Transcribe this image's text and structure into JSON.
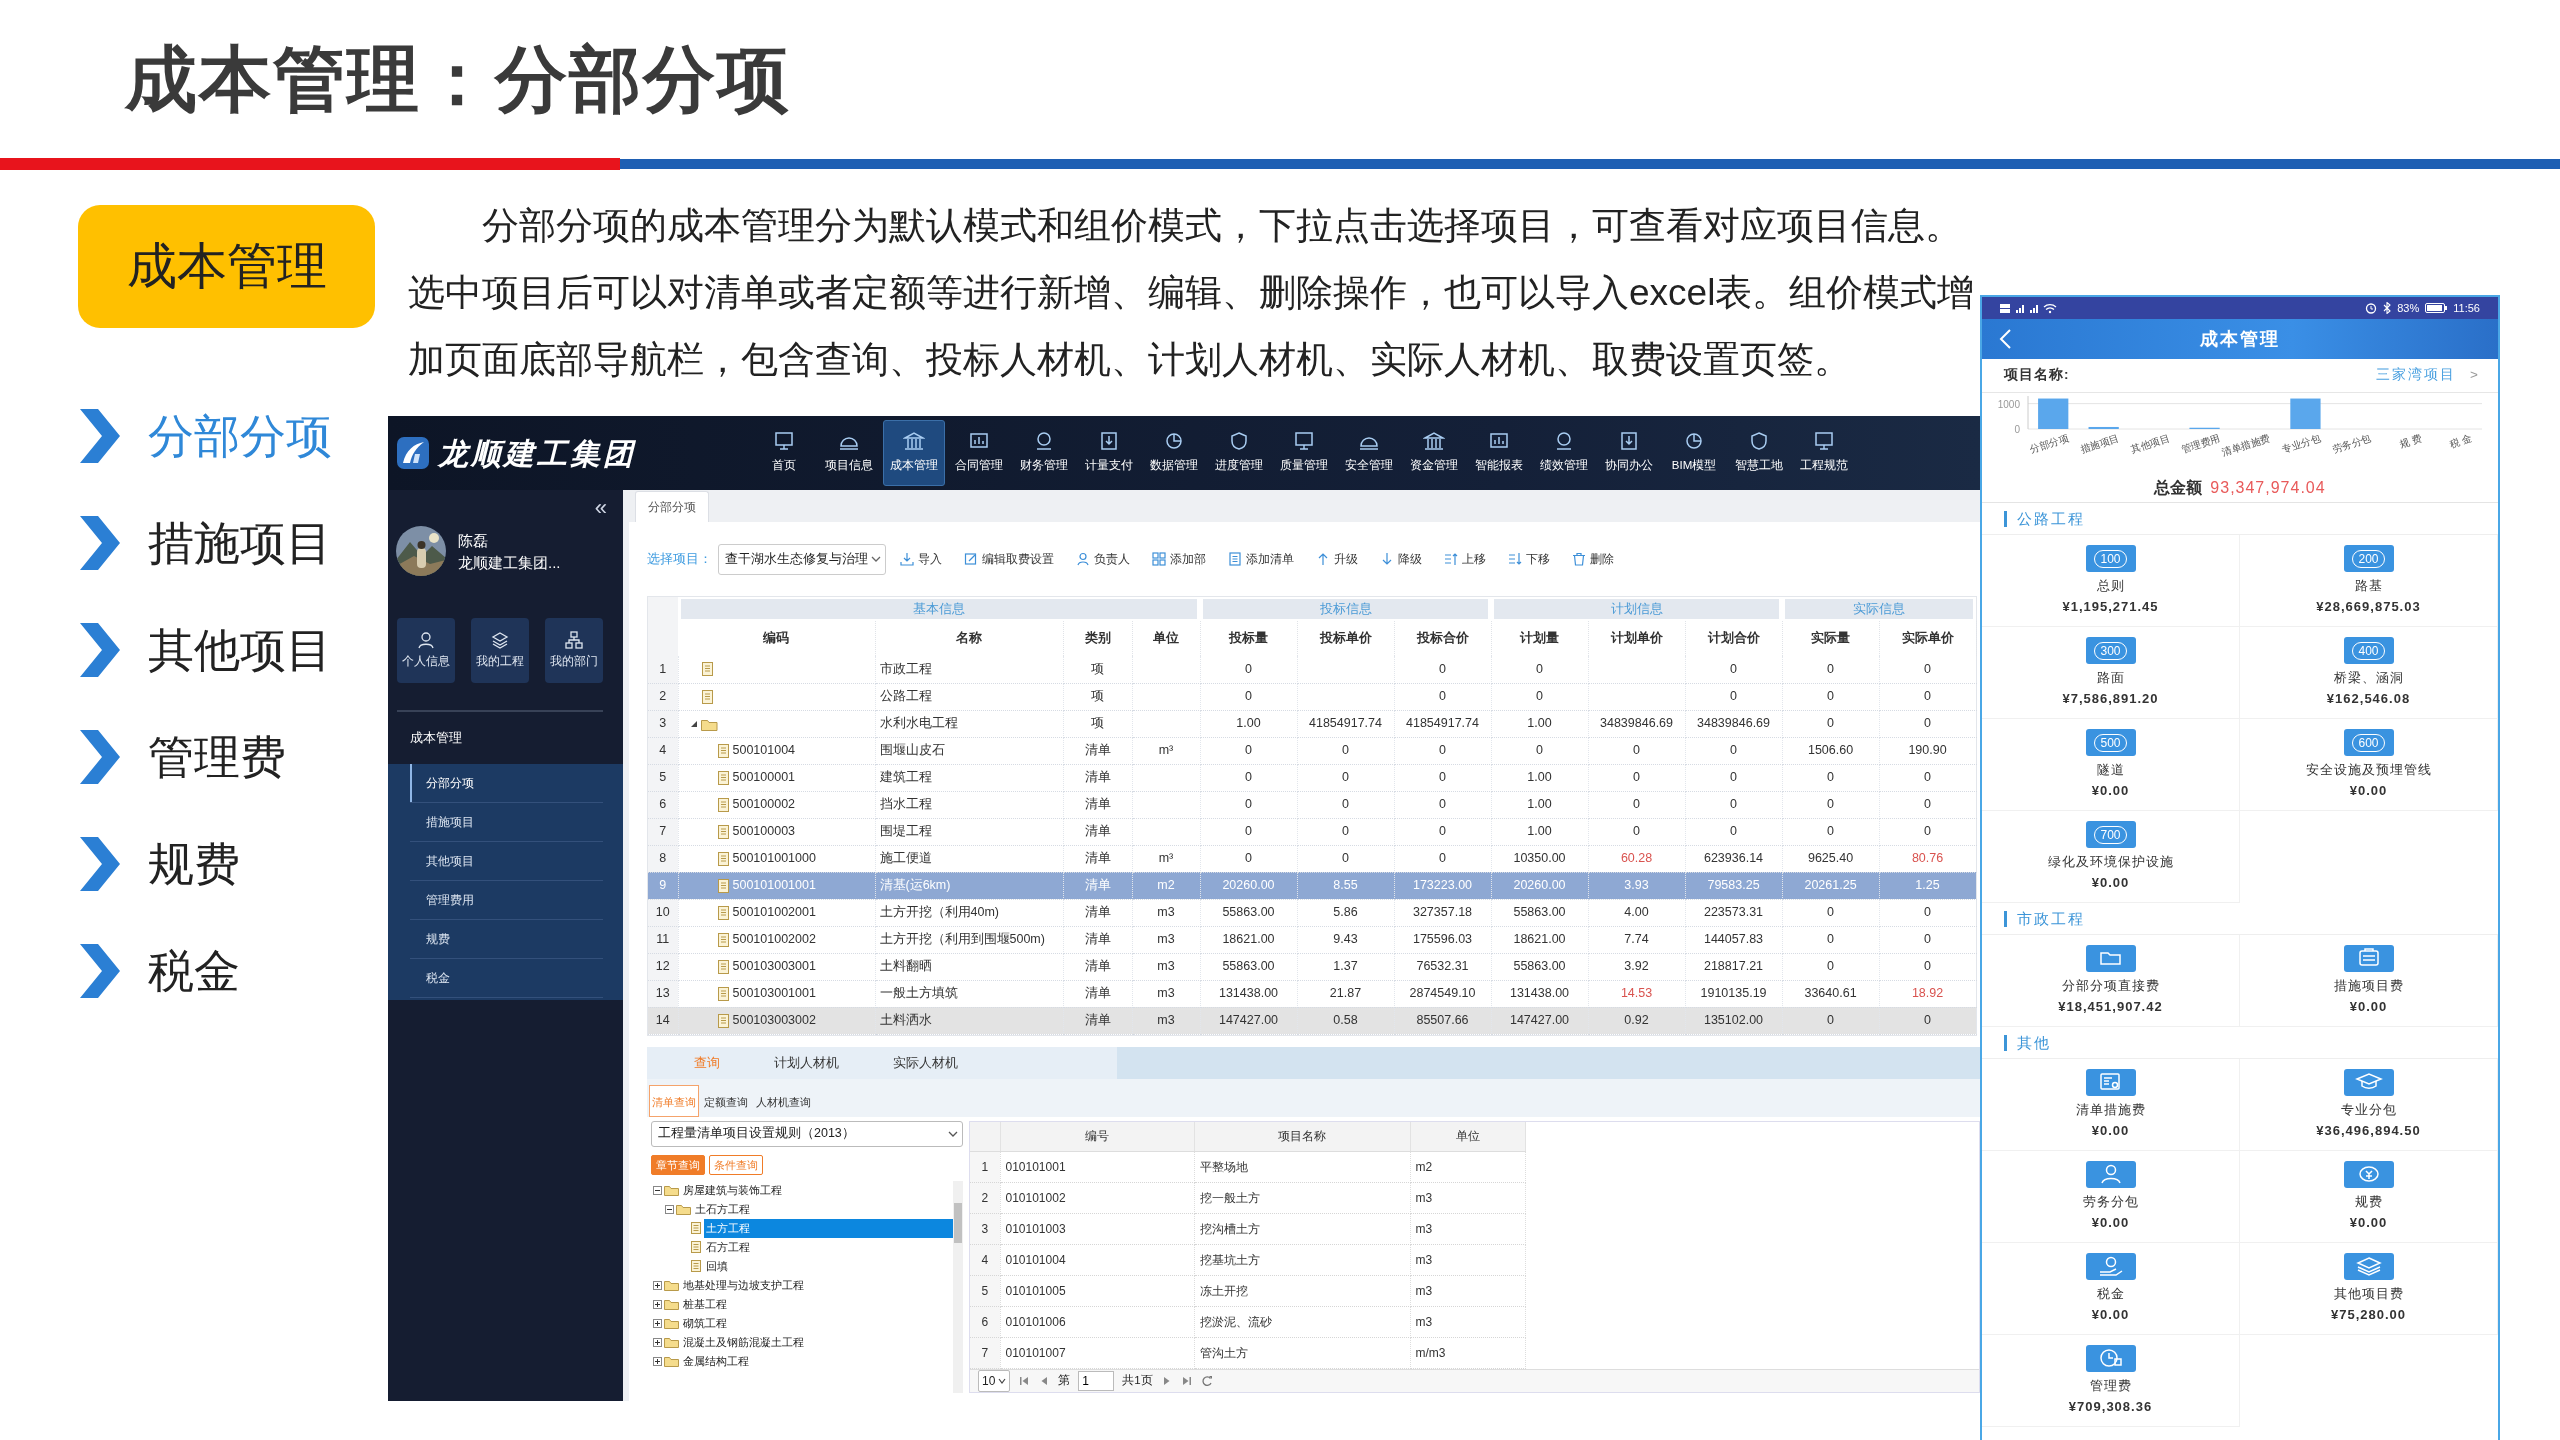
{
  "slide": {
    "title": "成本管理：分部分项"
  },
  "badge": "成本管理",
  "menu": [
    {
      "label": "分部分项",
      "selected": true
    },
    {
      "label": "措施项目",
      "selected": false
    },
    {
      "label": "其他项目",
      "selected": false
    },
    {
      "label": "管理费",
      "selected": false
    },
    {
      "label": "规费",
      "selected": false
    },
    {
      "label": "税金",
      "selected": false
    }
  ],
  "description": "分部分项的成本管理分为默认模式和组价模式，下拉点击选择项目，可查看对应项目信息。选中项目后可以对清单或者定额等进行新增、编辑、删除操作，也可以导入excel表。组价模式增加页面底部导航栏，包含查询、投标人材机、计划人材机、实际人材机、取费设置页签。",
  "app": {
    "logo": "龙顺建工集团",
    "nav": [
      {
        "label": "首页",
        "selected": false
      },
      {
        "label": "项目信息",
        "selected": false
      },
      {
        "label": "成本管理",
        "selected": true
      },
      {
        "label": "合同管理",
        "selected": false
      },
      {
        "label": "财务管理",
        "selected": false
      },
      {
        "label": "计量支付",
        "selected": false
      },
      {
        "label": "数据管理",
        "selected": false
      },
      {
        "label": "进度管理",
        "selected": false
      },
      {
        "label": "质量管理",
        "selected": false
      },
      {
        "label": "安全管理",
        "selected": false
      },
      {
        "label": "资金管理",
        "selected": false
      },
      {
        "label": "智能报表",
        "selected": false
      },
      {
        "label": "绩效管理",
        "selected": false
      },
      {
        "label": "协同办公",
        "selected": false
      },
      {
        "label": "BIM模型",
        "selected": false
      },
      {
        "label": "智慧工地",
        "selected": false
      },
      {
        "label": "工程规范",
        "selected": false
      }
    ],
    "sidebar": {
      "collapse": "«",
      "user": {
        "name": "陈磊",
        "org": "龙顺建工集团..."
      },
      "shortcuts": [
        "个人信息",
        "我的工程",
        "我的部门"
      ],
      "section": "成本管理",
      "items": [
        {
          "label": "分部分项",
          "selected": true
        },
        {
          "label": "措施项目",
          "selected": false
        },
        {
          "label": "其他项目",
          "selected": false
        },
        {
          "label": "管理费用",
          "selected": false
        },
        {
          "label": "规费",
          "selected": false
        },
        {
          "label": "税金",
          "selected": false
        }
      ]
    },
    "tab": "分部分项",
    "toolbar": {
      "project_label": "选择项目：",
      "project": "查干湖水生态修复与治理",
      "actions": [
        "导入",
        "编辑取费设置",
        "负责人",
        "添加部",
        "添加清单",
        "升级",
        "降级",
        "上移",
        "下移",
        "删除"
      ]
    },
    "table": {
      "groups": [
        "基本信息",
        "投标信息",
        "计划信息",
        "实际信息"
      ],
      "columns": [
        "编码",
        "名称",
        "类别",
        "单位",
        "投标量",
        "投标单价",
        "投标合价",
        "计划量",
        "计划单价",
        "计划合价",
        "实际量",
        "实际单价"
      ],
      "rows": [
        {
          "no": "1",
          "kind": "file",
          "name": "市政工程",
          "type": "项",
          "bid_qty": "0",
          "bid_total": "0",
          "plan_qty": "0",
          "plan_total": "0",
          "actual_qty": "0",
          "actual_price": "0",
          "selected": false,
          "hovered": false,
          "actual_price_alert": false
        },
        {
          "no": "2",
          "kind": "file",
          "name": "公路工程",
          "type": "项",
          "bid_qty": "0",
          "bid_total": "0",
          "plan_qty": "0",
          "plan_total": "0",
          "actual_qty": "0",
          "actual_price": "0",
          "selected": false,
          "hovered": false,
          "actual_price_alert": false
        },
        {
          "no": "3",
          "kind": "folder",
          "expanded": true,
          "name": "水利水电工程",
          "type": "项",
          "bid_qty": "1.00",
          "bid_price": "41854917.74",
          "bid_total": "41854917.74",
          "plan_qty": "1.00",
          "plan_price": "34839846.69",
          "plan_total": "34839846.69",
          "actual_qty": "0",
          "actual_price": "0",
          "selected": false,
          "hovered": false,
          "plan_price_alert": false,
          "actual_price_alert": false,
          "children": [
            {
              "no": "4",
              "kind": "file",
              "code": "500101004",
              "name": "围堰山皮石",
              "type": "清单",
              "unit": "m³",
              "bid_qty": "0",
              "bid_price": "0",
              "bid_total": "0",
              "plan_qty": "0",
              "plan_price": "0",
              "plan_total": "0",
              "actual_qty": "1506.60",
              "actual_price": "190.90",
              "selected": false,
              "hovered": false,
              "plan_price_alert": false,
              "actual_price_alert": false
            },
            {
              "no": "5",
              "kind": "file",
              "code": "500100001",
              "name": "建筑工程",
              "type": "清单",
              "bid_qty": "0",
              "bid_price": "0",
              "bid_total": "0",
              "plan_qty": "1.00",
              "plan_price": "0",
              "plan_total": "0",
              "actual_qty": "0",
              "actual_price": "0",
              "selected": false,
              "hovered": false,
              "plan_price_alert": false,
              "actual_price_alert": false
            },
            {
              "no": "6",
              "kind": "file",
              "code": "500100002",
              "name": "挡水工程",
              "type": "清单",
              "bid_qty": "0",
              "bid_price": "0",
              "bid_total": "0",
              "plan_qty": "1.00",
              "plan_price": "0",
              "plan_total": "0",
              "actual_qty": "0",
              "actual_price": "0",
              "selected": false,
              "hovered": false,
              "plan_price_alert": false,
              "actual_price_alert": false
            },
            {
              "no": "7",
              "kind": "file",
              "code": "500100003",
              "name": "围堤工程",
              "type": "清单",
              "bid_qty": "0",
              "bid_price": "0",
              "bid_total": "0",
              "plan_qty": "1.00",
              "plan_price": "0",
              "plan_total": "0",
              "actual_qty": "0",
              "actual_price": "0",
              "selected": false,
              "hovered": false,
              "plan_price_alert": false,
              "actual_price_alert": false
            },
            {
              "no": "8",
              "kind": "file",
              "code": "500101001000",
              "name": "施工便道",
              "type": "清单",
              "unit": "m³",
              "bid_qty": "0",
              "bid_price": "0",
              "bid_total": "0",
              "plan_qty": "10350.00",
              "plan_price": "60.28",
              "plan_total": "623936.14",
              "actual_qty": "9625.40",
              "actual_price": "80.76",
              "selected": false,
              "hovered": false,
              "plan_price_alert": true,
              "actual_price_alert": true
            },
            {
              "no": "9",
              "kind": "file",
              "code": "500101001001",
              "name": "清基(运6km)",
              "type": "清单",
              "unit": "m2",
              "bid_qty": "20260.00",
              "bid_price": "8.55",
              "bid_total": "173223.00",
              "plan_qty": "20260.00",
              "plan_price": "3.93",
              "plan_total": "79583.25",
              "actual_qty": "20261.25",
              "actual_price": "1.25",
              "selected": true,
              "hovered": false,
              "plan_price_alert": false,
              "actual_price_alert": false
            },
            {
              "no": "10",
              "kind": "file",
              "code": "500101002001",
              "name": "土方开挖（利用40m)",
              "type": "清单",
              "unit": "m3",
              "bid_qty": "55863.00",
              "bid_price": "5.86",
              "bid_total": "327357.18",
              "plan_qty": "55863.00",
              "plan_price": "4.00",
              "plan_total": "223573.31",
              "actual_qty": "0",
              "actual_price": "0",
              "selected": false,
              "hovered": false,
              "plan_price_alert": false,
              "actual_price_alert": false
            },
            {
              "no": "11",
              "kind": "file",
              "code": "500101002002",
              "name": "土方开挖（利用到围堰500m)",
              "type": "清单",
              "unit": "m3",
              "bid_qty": "18621.00",
              "bid_price": "9.43",
              "bid_total": "175596.03",
              "plan_qty": "18621.00",
              "plan_price": "7.74",
              "plan_total": "144057.83",
              "actual_qty": "0",
              "actual_price": "0",
              "selected": false,
              "hovered": false,
              "plan_price_alert": false,
              "actual_price_alert": false
            },
            {
              "no": "12",
              "kind": "file",
              "code": "500103003001",
              "name": "土料翻晒",
              "type": "清单",
              "unit": "m3",
              "bid_qty": "55863.00",
              "bid_price": "1.37",
              "bid_total": "76532.31",
              "plan_qty": "55863.00",
              "plan_price": "3.92",
              "plan_total": "218817.21",
              "actual_qty": "0",
              "actual_price": "0",
              "selected": false,
              "hovered": false,
              "plan_price_alert": false,
              "actual_price_alert": false
            },
            {
              "no": "13",
              "kind": "file",
              "code": "500103001001",
              "name": "一般土方填筑",
              "type": "清单",
              "unit": "m3",
              "bid_qty": "131438.00",
              "bid_price": "21.87",
              "bid_total": "2874549.10",
              "plan_qty": "131438.00",
              "plan_price": "14.53",
              "plan_total": "1910135.19",
              "actual_qty": "33640.61",
              "actual_price": "18.92",
              "selected": false,
              "hovered": false,
              "plan_price_alert": true,
              "actual_price_alert": true
            },
            {
              "no": "14",
              "kind": "file",
              "code": "500103003002",
              "name": "土料洒水",
              "type": "清单",
              "unit": "m3",
              "bid_qty": "147427.00",
              "bid_price": "0.58",
              "bid_total": "85507.66",
              "plan_qty": "147427.00",
              "plan_price": "0.92",
              "plan_total": "135102.00",
              "actual_qty": "0",
              "actual_price": "0",
              "selected": false,
              "hovered": true,
              "plan_price_alert": false,
              "actual_price_alert": false
            }
          ]
        }
      ]
    },
    "bottom": {
      "tabs": [
        {
          "label": "查询",
          "selected": true
        },
        {
          "label": "计划人材机",
          "selected": false
        },
        {
          "label": "实际人材机",
          "selected": false
        }
      ],
      "subtabs": [
        {
          "label": "清单查询",
          "selected": true
        },
        {
          "label": "定额查询",
          "selected": false
        },
        {
          "label": "人材机查询",
          "selected": false
        }
      ],
      "rule_select": "工程量清单项目设置规则（2013）",
      "modes": [
        {
          "label": "章节查询",
          "selected": true
        },
        {
          "label": "条件查询",
          "selected": false
        }
      ],
      "tree": [
        {
          "label": "房屋建筑与装饰工程",
          "kind": "folder",
          "expanded": true,
          "selected": false,
          "children": [
            {
              "label": "土石方工程",
              "kind": "folder",
              "expanded": true,
              "selected": false,
              "children": [
                {
                  "label": "土方工程",
                  "kind": "file",
                  "selected": true
                },
                {
                  "label": "石方工程",
                  "kind": "file",
                  "selected": false
                },
                {
                  "label": "回填",
                  "kind": "file",
                  "selected": false
                }
              ]
            }
          ]
        },
        {
          "label": "地基处理与边坡支护工程",
          "kind": "folder",
          "expanded": false,
          "selected": false
        },
        {
          "label": "桩基工程",
          "kind": "folder",
          "expanded": false,
          "selected": false
        },
        {
          "label": "砌筑工程",
          "kind": "folder",
          "expanded": false,
          "selected": false
        },
        {
          "label": "混凝土及钢筋混凝土工程",
          "kind": "folder",
          "expanded": false,
          "selected": false
        },
        {
          "label": "金属结构工程",
          "kind": "folder",
          "expanded": false,
          "selected": false
        }
      ],
      "columns": [
        "编号",
        "项目名称",
        "单位"
      ],
      "rows": [
        {
          "no": "1",
          "code": "010101001",
          "name": "平整场地",
          "unit": "m2"
        },
        {
          "no": "2",
          "code": "010101002",
          "name": "挖一般土方",
          "unit": "m3"
        },
        {
          "no": "3",
          "code": "010101003",
          "name": "挖沟槽土方",
          "unit": "m3"
        },
        {
          "no": "4",
          "code": "010101004",
          "name": "挖基坑土方",
          "unit": "m3"
        },
        {
          "no": "5",
          "code": "010101005",
          "name": "冻土开挖",
          "unit": "m3"
        },
        {
          "no": "6",
          "code": "010101006",
          "name": "挖淤泥、流砂",
          "unit": "m3"
        },
        {
          "no": "7",
          "code": "010101007",
          "name": "管沟土方",
          "unit": "m/m3"
        }
      ],
      "pager": {
        "page_size": "10",
        "page_prefix": "第",
        "page": "1",
        "total": "共1页"
      }
    }
  },
  "mobile": {
    "status": {
      "battery": "83%",
      "time": "11:56"
    },
    "title": "成本管理",
    "project_label": "项目名称:",
    "project": "三家湾项目",
    "project_arrow": ">",
    "chart_data": {
      "type": "bar",
      "categories": [
        "分部分项",
        "措施项目",
        "其他项目",
        "管理费用",
        "清单措施费",
        "专业分包",
        "劳务分包",
        "规 费",
        "税 金"
      ],
      "values": [
        1200,
        80,
        0,
        50,
        0,
        1200,
        0,
        0,
        0
      ],
      "ylim": [
        0,
        1300
      ],
      "yticks": [
        0,
        1000
      ]
    },
    "total_label": "总金额",
    "total": "93,347,974.04",
    "sections": [
      {
        "title": "公路工程",
        "tiles": [
          {
            "kind": "number",
            "code": "100",
            "label": "总则",
            "value": "¥1,195,271.45"
          },
          {
            "kind": "number",
            "code": "200",
            "label": "路基",
            "value": "¥28,669,875.03"
          },
          {
            "kind": "number",
            "code": "300",
            "label": "路面",
            "value": "¥7,586,891.20"
          },
          {
            "kind": "number",
            "code": "400",
            "label": "桥梁、涵洞",
            "value": "¥162,546.08"
          },
          {
            "kind": "number",
            "code": "500",
            "label": "隧道",
            "value": "¥0.00"
          },
          {
            "kind": "number",
            "code": "600",
            "label": "安全设施及预埋管线",
            "value": "¥0.00"
          },
          {
            "kind": "number",
            "code": "700",
            "label": "绿化及环境保护设施",
            "value": "¥0.00"
          }
        ]
      },
      {
        "title": "市政工程",
        "tiles": [
          {
            "kind": "folder",
            "label": "分部分项直接费",
            "value": "¥18,451,907.42"
          },
          {
            "kind": "clipboard",
            "label": "措施项目费",
            "value": "¥0.00"
          }
        ]
      },
      {
        "title": "其他",
        "tiles": [
          {
            "kind": "document",
            "label": "清单措施费",
            "value": "¥0.00"
          },
          {
            "kind": "cap",
            "label": "专业分包",
            "value": "¥36,496,894.50"
          },
          {
            "kind": "person",
            "label": "劳务分包",
            "value": "¥0.00"
          },
          {
            "kind": "coin",
            "label": "规费",
            "value": "¥0.00"
          },
          {
            "kind": "hand",
            "label": "税金",
            "value": "¥0.00"
          },
          {
            "kind": "layers",
            "label": "其他项目费",
            "value": "¥75,280.00"
          },
          {
            "kind": "clock",
            "label": "管理费",
            "value": "¥709,308.36"
          }
        ]
      }
    ]
  }
}
